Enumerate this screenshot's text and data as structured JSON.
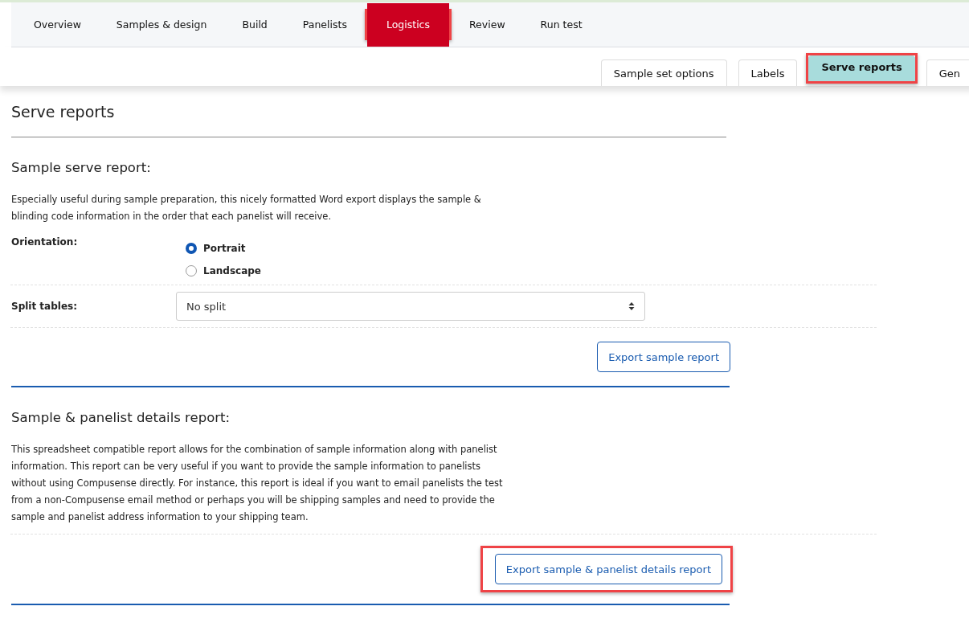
{
  "nav_tabs": [
    {
      "label": "Overview",
      "selected": false,
      "highlighted": false
    },
    {
      "label": "Samples & design",
      "selected": false,
      "highlighted": false
    },
    {
      "label": "Build",
      "selected": false,
      "highlighted": false
    },
    {
      "label": "Panelists",
      "selected": false,
      "highlighted": false
    },
    {
      "label": "Logistics",
      "selected": true,
      "highlighted": true
    },
    {
      "label": "Review",
      "selected": false,
      "highlighted": false
    },
    {
      "label": "Run test",
      "selected": false,
      "highlighted": false
    }
  ],
  "sub_tabs": [
    {
      "label": "Sample set options",
      "selected": false,
      "highlighted": false
    },
    {
      "label": "Labels",
      "selected": false,
      "highlighted": false
    },
    {
      "label": "Serve reports",
      "selected": true,
      "highlighted": true
    },
    {
      "label": "Gen",
      "selected": false,
      "highlighted": false
    }
  ],
  "page_title": "Serve reports",
  "serve_report": {
    "heading": "Sample serve report:",
    "description": "Especially useful during sample preparation, this nicely formatted Word export displays the sample & blinding code information in the order that each panelist will receive.",
    "orientation": {
      "label": "Orientation:",
      "options": [
        {
          "label": "Portrait",
          "selected": true
        },
        {
          "label": "Landscape",
          "selected": false
        }
      ]
    },
    "split_tables": {
      "label": "Split tables:",
      "value": "No split"
    },
    "button": {
      "label": "Export sample report",
      "highlighted": false
    }
  },
  "details_report": {
    "heading": "Sample & panelist details report:",
    "description": "This spreadsheet compatible report allows for the combination of sample information along with panelist information. This report can be very useful if you want to provide the sample information to panelists without using Compusense directly. For instance, this report is ideal if you want to email panelists the test from a non-Compusense email method or perhaps you will be shipping samples and need to provide the sample and panelist address information to your shipping team.",
    "button": {
      "label": "Export sample & panelist details report",
      "highlighted": true
    }
  }
}
